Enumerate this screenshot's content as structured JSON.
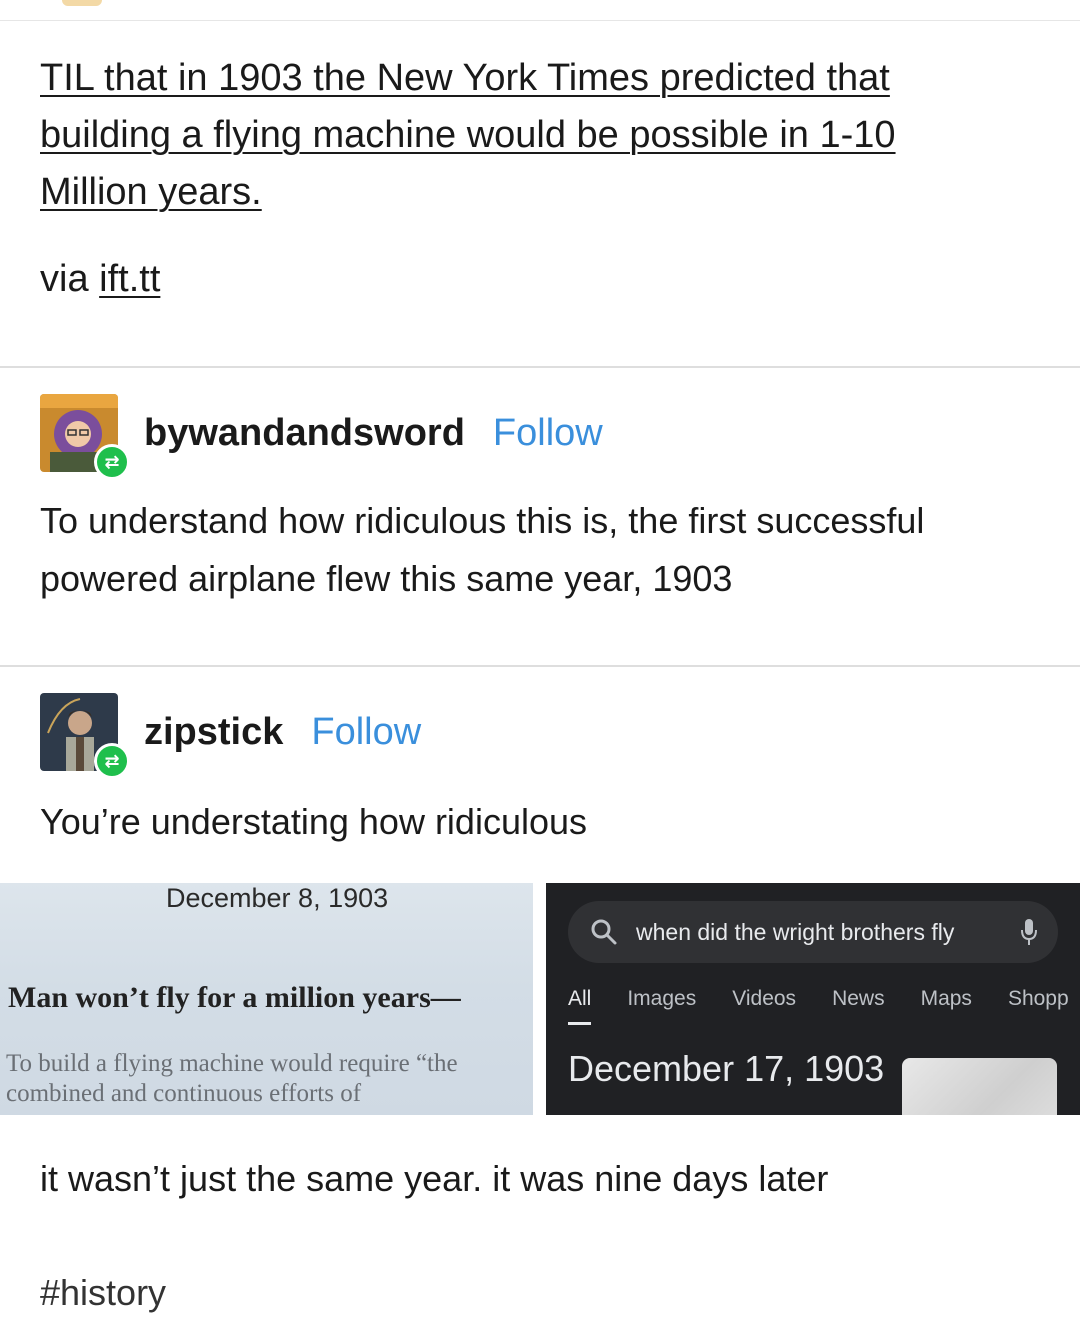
{
  "original_post": {
    "title_link": "TIL that in 1903 the New York Times predicted that building a flying machine would be possible in 1-10 Million years.",
    "via_prefix": "via",
    "via_link": "ift.tt"
  },
  "reblogs": [
    {
      "username": "bywandandsword",
      "follow_label": "Follow",
      "text": "To understand how ridiculous this is, the first successful powered airplane flew this same year, 1903"
    },
    {
      "username": "zipstick",
      "follow_label": "Follow",
      "text": "You’re understating how ridiculous",
      "text_after": "it wasn’t just the same year. it was nine days later"
    }
  ],
  "news_clipping": {
    "date": "December 8, 1903",
    "headline": "Man won’t fly for a million years—",
    "body": "To build a flying machine would require “the combined and continuous efforts of"
  },
  "search_screenshot": {
    "query": "when did the wright brothers fly",
    "tabs": [
      "All",
      "Images",
      "Videos",
      "News",
      "Maps",
      "Shopp"
    ],
    "active_tab": "All",
    "answer": "December 17, 1903"
  },
  "tags": [
    "#history"
  ],
  "colors": {
    "follow": "#3a8fdc",
    "reblog_badge": "#1fbf4c",
    "search_bg": "#202124"
  }
}
